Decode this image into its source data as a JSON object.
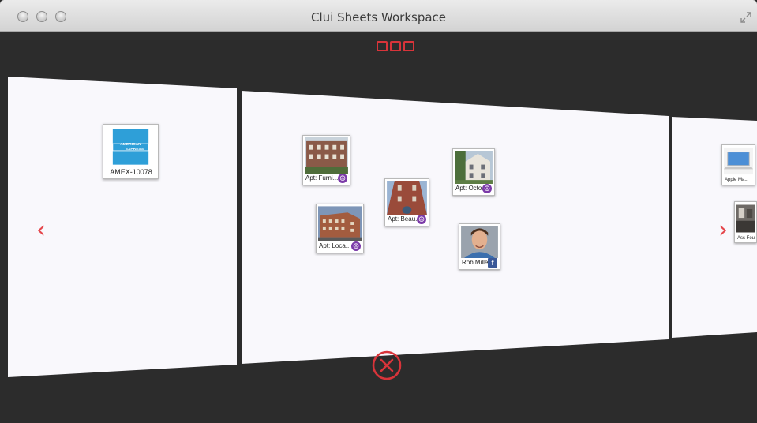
{
  "window": {
    "title": "Clui Sheets Workspace"
  },
  "accent": "#d8343a",
  "sheets": {
    "left": {
      "cards": [
        {
          "label": "AMEX-10078",
          "icon": "amex-logo"
        }
      ]
    },
    "center": {
      "cards": [
        {
          "label": "Apt: Furni...",
          "badge": "☮"
        },
        {
          "label": "Apt: Beau...",
          "badge": "☮"
        },
        {
          "label": "Apt: Octo...",
          "badge": "☮"
        },
        {
          "label": "Apt: Loca...",
          "badge": "☮"
        },
        {
          "label": "Rob Miller",
          "badge": "f"
        }
      ]
    },
    "right": {
      "cards": [
        {
          "label": "Apple Ma...",
          "badge": "apple"
        },
        {
          "label": "Ass Four"
        }
      ]
    }
  },
  "nav": {
    "prev": "‹",
    "next": "›"
  },
  "footer": {
    "close_icon": "close-circle-icon"
  }
}
